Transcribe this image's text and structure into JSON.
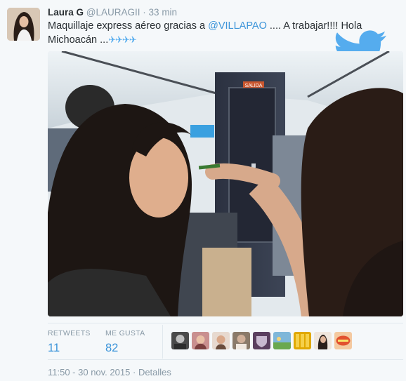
{
  "tweet": {
    "fullname": "Laura G",
    "username": "@LAURAGII",
    "separator": "·",
    "time": "33 min",
    "text_part1": "Maquillaje express aéreo gracias a ",
    "mention": "@VILLAPAO",
    "text_part2": " .... A trabajar!!!! Hola Michoacán ...",
    "emoji": "✈✈✈✈"
  },
  "photo": {
    "sign_text": "SALIDA"
  },
  "stats": {
    "retweets_label": "RETWEETS",
    "retweets_value": "11",
    "likes_label": "ME GUSTA",
    "likes_value": "82"
  },
  "footer": {
    "timestamp": "11:50 - 30 nov. 2015",
    "separator": "·",
    "details": "Detalles"
  },
  "colors": {
    "link": "#3b94d9",
    "twitter_blue": "#55acee",
    "muted": "#8899a6",
    "background": "#f5f8fa"
  }
}
